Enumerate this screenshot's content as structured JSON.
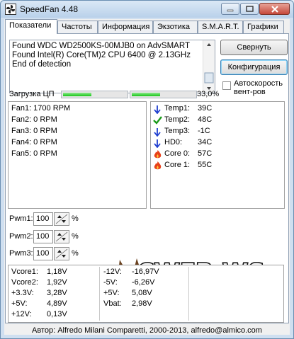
{
  "window": {
    "title": "SpeedFan 4.48",
    "icon": "fan-icon"
  },
  "tabs": [
    {
      "label": "Показатели"
    },
    {
      "label": "Частоты"
    },
    {
      "label": "Информация"
    },
    {
      "label": "Экзотика"
    },
    {
      "label": "S.M.A.R.T."
    },
    {
      "label": "Графики"
    }
  ],
  "log": [
    "Found WDC WD2500KS-00MJB0 on AdvSMART",
    "Found Intel(R) Core(TM)2 CPU 6400 @ 2.13GHz",
    "End of detection"
  ],
  "buttons": {
    "minimize": "Свернуть",
    "config": "Конфигурация"
  },
  "autospeed": {
    "label_line1": "Автоскорость",
    "label_line2": "вент-ров",
    "checked": false
  },
  "cpu_load": {
    "label": "Загрузка ЦП",
    "value": "33,0%",
    "core1_fraction": 0.45,
    "core2_fraction": 0.45
  },
  "fans": [
    "Fan1: 1700 RPM",
    "Fan2: 0 RPM",
    "Fan3: 0 RPM",
    "Fan4: 0 RPM",
    "Fan5: 0 RPM"
  ],
  "temps": [
    {
      "label": "Temp1:",
      "value": "39C",
      "icon": "arrow-down-icon"
    },
    {
      "label": "Temp2:",
      "value": "48C",
      "icon": "checkmark-icon"
    },
    {
      "label": "Temp3:",
      "value": "-1C",
      "icon": "arrow-down-icon"
    },
    {
      "label": "HD0:",
      "value": "34C",
      "icon": "arrow-down-icon"
    },
    {
      "label": "Core 0:",
      "value": "57C",
      "icon": "flame-icon"
    },
    {
      "label": "Core 1:",
      "value": "55C",
      "icon": "flame-icon"
    }
  ],
  "pwm": [
    {
      "label": "Pwm1:",
      "value": "100",
      "unit": "%"
    },
    {
      "label": "Pwm2:",
      "value": "100",
      "unit": "%"
    },
    {
      "label": "Pwm3:",
      "value": "100",
      "unit": "%"
    }
  ],
  "voltages_left": [
    {
      "label": "Vcore1:",
      "value": "1,18V"
    },
    {
      "label": "Vcore2:",
      "value": "1,92V"
    },
    {
      "label": "+3.3V:",
      "value": "3,28V"
    },
    {
      "label": "+5V:",
      "value": "4,89V"
    },
    {
      "label": "+12V:",
      "value": "0,13V"
    }
  ],
  "voltages_right": [
    {
      "label": "-12V:",
      "value": "-16,97V"
    },
    {
      "label": "-5V:",
      "value": "-6,26V"
    },
    {
      "label": "+5V:",
      "value": "5,08V"
    },
    {
      "label": "Vbat:",
      "value": "2,98V"
    }
  ],
  "watermark": {
    "text": "CWER.WS"
  },
  "status": "Автор: Alfredo Milani Comparetti, 2000-2013, alfredo@almico.com",
  "colors": {
    "progress": "#16c616",
    "arrow": "#1f3fd0",
    "check": "#1a9a1a",
    "flame": "#e8401a"
  }
}
